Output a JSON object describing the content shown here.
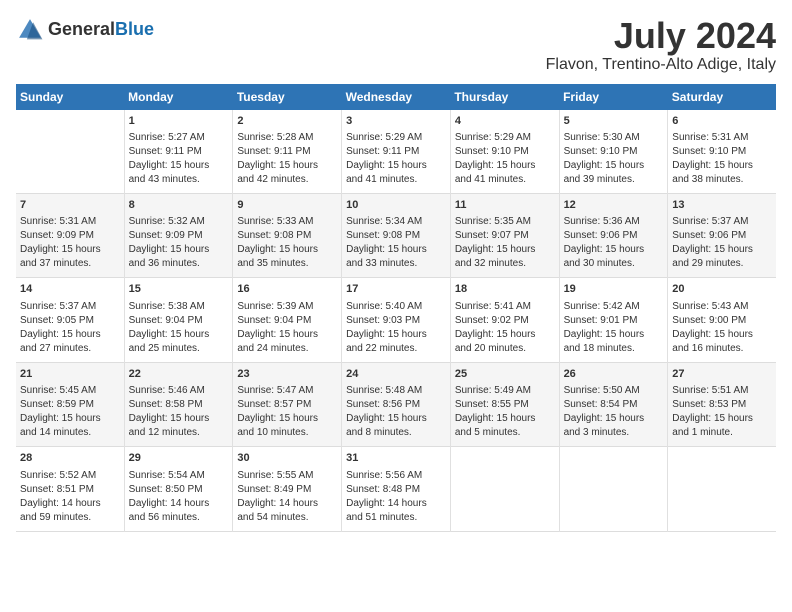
{
  "app": {
    "name_general": "General",
    "name_blue": "Blue"
  },
  "title": {
    "month_year": "July 2024",
    "location": "Flavon, Trentino-Alto Adige, Italy"
  },
  "calendar": {
    "headers": [
      "Sunday",
      "Monday",
      "Tuesday",
      "Wednesday",
      "Thursday",
      "Friday",
      "Saturday"
    ],
    "weeks": [
      [
        {
          "day": "",
          "info": ""
        },
        {
          "day": "1",
          "info": "Sunrise: 5:27 AM\nSunset: 9:11 PM\nDaylight: 15 hours\nand 43 minutes."
        },
        {
          "day": "2",
          "info": "Sunrise: 5:28 AM\nSunset: 9:11 PM\nDaylight: 15 hours\nand 42 minutes."
        },
        {
          "day": "3",
          "info": "Sunrise: 5:29 AM\nSunset: 9:11 PM\nDaylight: 15 hours\nand 41 minutes."
        },
        {
          "day": "4",
          "info": "Sunrise: 5:29 AM\nSunset: 9:10 PM\nDaylight: 15 hours\nand 41 minutes."
        },
        {
          "day": "5",
          "info": "Sunrise: 5:30 AM\nSunset: 9:10 PM\nDaylight: 15 hours\nand 39 minutes."
        },
        {
          "day": "6",
          "info": "Sunrise: 5:31 AM\nSunset: 9:10 PM\nDaylight: 15 hours\nand 38 minutes."
        }
      ],
      [
        {
          "day": "7",
          "info": "Sunrise: 5:31 AM\nSunset: 9:09 PM\nDaylight: 15 hours\nand 37 minutes."
        },
        {
          "day": "8",
          "info": "Sunrise: 5:32 AM\nSunset: 9:09 PM\nDaylight: 15 hours\nand 36 minutes."
        },
        {
          "day": "9",
          "info": "Sunrise: 5:33 AM\nSunset: 9:08 PM\nDaylight: 15 hours\nand 35 minutes."
        },
        {
          "day": "10",
          "info": "Sunrise: 5:34 AM\nSunset: 9:08 PM\nDaylight: 15 hours\nand 33 minutes."
        },
        {
          "day": "11",
          "info": "Sunrise: 5:35 AM\nSunset: 9:07 PM\nDaylight: 15 hours\nand 32 minutes."
        },
        {
          "day": "12",
          "info": "Sunrise: 5:36 AM\nSunset: 9:06 PM\nDaylight: 15 hours\nand 30 minutes."
        },
        {
          "day": "13",
          "info": "Sunrise: 5:37 AM\nSunset: 9:06 PM\nDaylight: 15 hours\nand 29 minutes."
        }
      ],
      [
        {
          "day": "14",
          "info": "Sunrise: 5:37 AM\nSunset: 9:05 PM\nDaylight: 15 hours\nand 27 minutes."
        },
        {
          "day": "15",
          "info": "Sunrise: 5:38 AM\nSunset: 9:04 PM\nDaylight: 15 hours\nand 25 minutes."
        },
        {
          "day": "16",
          "info": "Sunrise: 5:39 AM\nSunset: 9:04 PM\nDaylight: 15 hours\nand 24 minutes."
        },
        {
          "day": "17",
          "info": "Sunrise: 5:40 AM\nSunset: 9:03 PM\nDaylight: 15 hours\nand 22 minutes."
        },
        {
          "day": "18",
          "info": "Sunrise: 5:41 AM\nSunset: 9:02 PM\nDaylight: 15 hours\nand 20 minutes."
        },
        {
          "day": "19",
          "info": "Sunrise: 5:42 AM\nSunset: 9:01 PM\nDaylight: 15 hours\nand 18 minutes."
        },
        {
          "day": "20",
          "info": "Sunrise: 5:43 AM\nSunset: 9:00 PM\nDaylight: 15 hours\nand 16 minutes."
        }
      ],
      [
        {
          "day": "21",
          "info": "Sunrise: 5:45 AM\nSunset: 8:59 PM\nDaylight: 15 hours\nand 14 minutes."
        },
        {
          "day": "22",
          "info": "Sunrise: 5:46 AM\nSunset: 8:58 PM\nDaylight: 15 hours\nand 12 minutes."
        },
        {
          "day": "23",
          "info": "Sunrise: 5:47 AM\nSunset: 8:57 PM\nDaylight: 15 hours\nand 10 minutes."
        },
        {
          "day": "24",
          "info": "Sunrise: 5:48 AM\nSunset: 8:56 PM\nDaylight: 15 hours\nand 8 minutes."
        },
        {
          "day": "25",
          "info": "Sunrise: 5:49 AM\nSunset: 8:55 PM\nDaylight: 15 hours\nand 5 minutes."
        },
        {
          "day": "26",
          "info": "Sunrise: 5:50 AM\nSunset: 8:54 PM\nDaylight: 15 hours\nand 3 minutes."
        },
        {
          "day": "27",
          "info": "Sunrise: 5:51 AM\nSunset: 8:53 PM\nDaylight: 15 hours\nand 1 minute."
        }
      ],
      [
        {
          "day": "28",
          "info": "Sunrise: 5:52 AM\nSunset: 8:51 PM\nDaylight: 14 hours\nand 59 minutes."
        },
        {
          "day": "29",
          "info": "Sunrise: 5:54 AM\nSunset: 8:50 PM\nDaylight: 14 hours\nand 56 minutes."
        },
        {
          "day": "30",
          "info": "Sunrise: 5:55 AM\nSunset: 8:49 PM\nDaylight: 14 hours\nand 54 minutes."
        },
        {
          "day": "31",
          "info": "Sunrise: 5:56 AM\nSunset: 8:48 PM\nDaylight: 14 hours\nand 51 minutes."
        },
        {
          "day": "",
          "info": ""
        },
        {
          "day": "",
          "info": ""
        },
        {
          "day": "",
          "info": ""
        }
      ]
    ]
  }
}
